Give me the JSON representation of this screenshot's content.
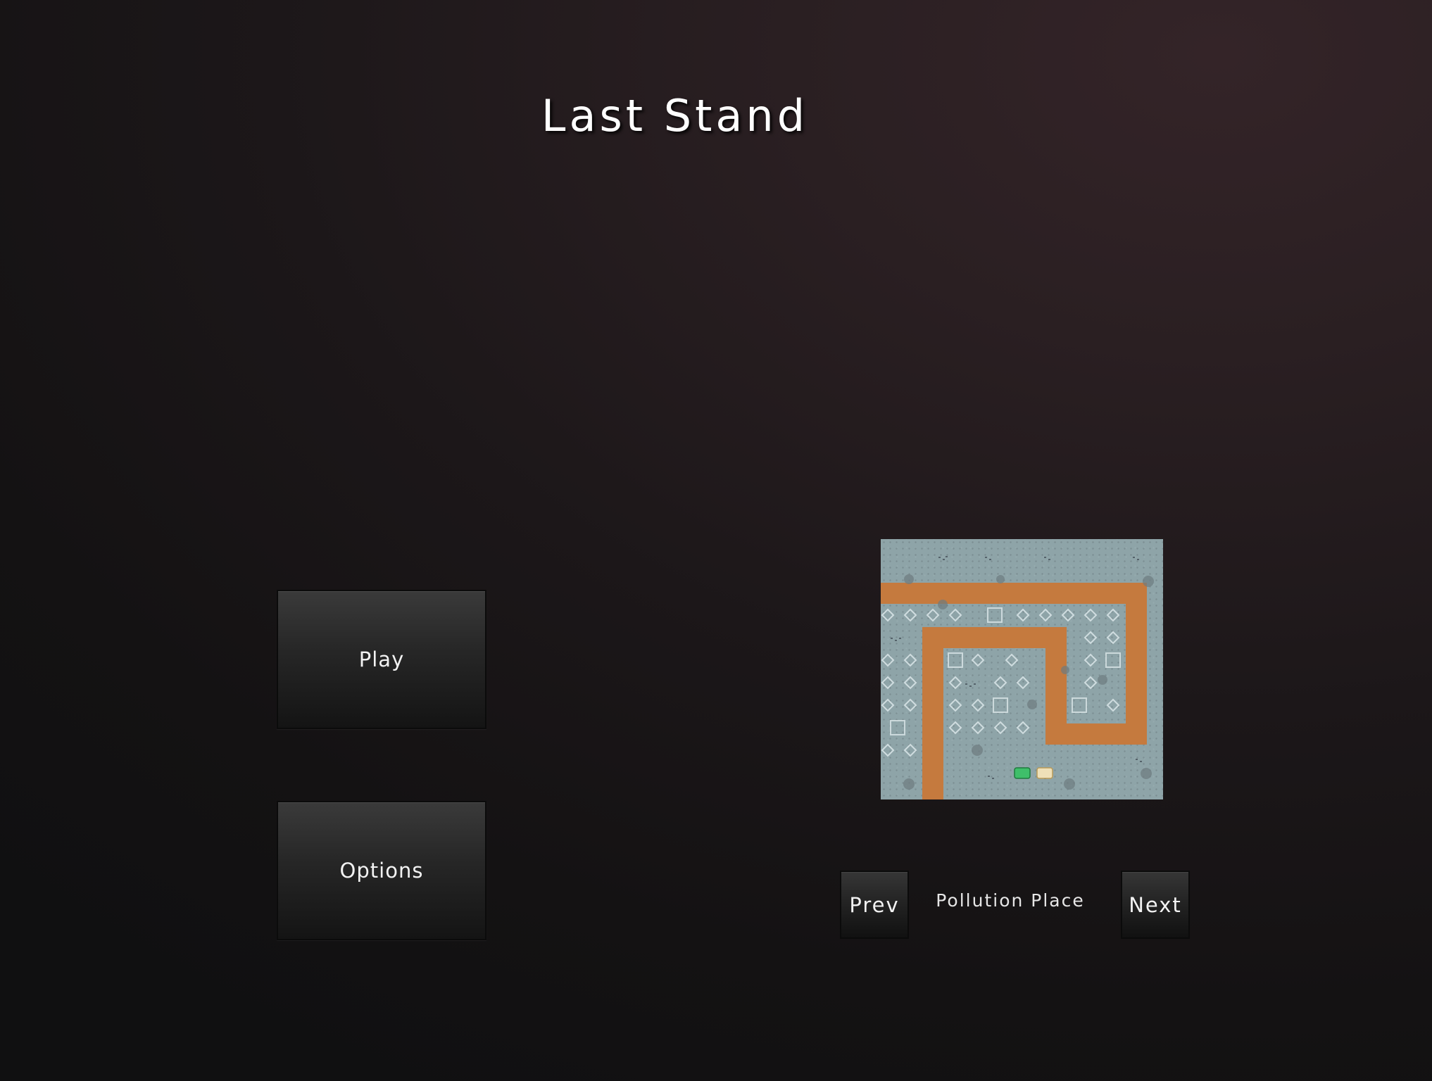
{
  "title": "Last Stand",
  "menu": {
    "play_label": "Play",
    "options_label": "Options"
  },
  "level_select": {
    "prev_label": "Prev",
    "next_label": "Next",
    "map_name": "Pollution Place"
  },
  "colors": {
    "path": "#c57a3e",
    "ground": "#8ea4a8",
    "tower_green": "#3fbf6a",
    "tower_cream": "#efe0b8"
  }
}
